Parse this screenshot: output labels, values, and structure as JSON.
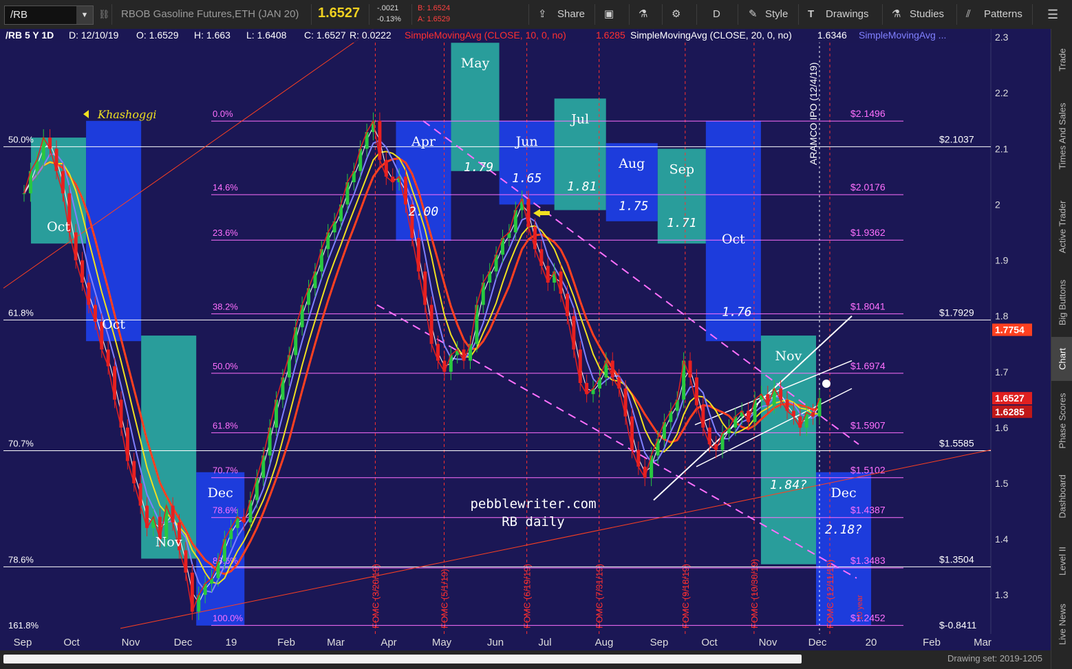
{
  "toolbar": {
    "symbol": "/RB",
    "description": "RBOB Gasoline Futures,ETH (JAN 20)",
    "last": "1.6527",
    "change": "-.0021",
    "change_pct": "-0.13%",
    "bid": "B: 1.6524",
    "ask": "A: 1.6529",
    "share": "Share",
    "style": "Style",
    "drawings": "Drawings",
    "studies": "Studies",
    "patterns": "Patterns",
    "aggregation": "D"
  },
  "sidebar": {
    "tabs": [
      "Trade",
      "Times And Sales",
      "Active Trader",
      "Big Buttons",
      "Chart",
      "Phase Scores",
      "Dashboard",
      "Level II",
      "Live News"
    ]
  },
  "bottom": {
    "drawing_set": "Drawing set: 2019-1205"
  },
  "colors": {
    "background": "#1b1755",
    "green_box": "#2aa8a0",
    "blue_box": "#1d3fe6",
    "fib": "#ff70ff",
    "sma10": "#e02020",
    "sma20": "#ffffff",
    "sma50": "#8080ff",
    "sma100": "#f0e020",
    "sma200": "#ff4020"
  },
  "chart_data": {
    "type": "candlestick",
    "title": "/RB 5 Y 1D",
    "header": {
      "date": "D: 12/10/19",
      "open": "O: 1.6529",
      "high": "H: 1.663",
      "low": "L: 1.6408",
      "close": "C: 1.6527",
      "range": "R: 0.0222",
      "sma10": "SimpleMovingAvg (CLOSE, 10, 0, no)",
      "sma10_value": "1.6285",
      "sma20": "SimpleMovingAvg (CLOSE, 20, 0, no)",
      "sma20_value": "1.6346",
      "sma_more": "SimpleMovingAvg ..."
    },
    "x_ticks": [
      "Sep",
      "Oct",
      "Nov",
      "Dec",
      "19",
      "Feb",
      "Mar",
      "Apr",
      "May",
      "Jun",
      "Jul",
      "Aug",
      "Sep",
      "Oct",
      "Nov",
      "Dec",
      "20",
      "Feb",
      "Mar"
    ],
    "y_ticks": [
      1.3,
      1.4,
      1.5,
      1.6,
      1.7,
      1.8,
      1.9,
      2.0,
      2.1,
      2.2,
      2.3
    ],
    "y_tick_labels": [
      "1.3",
      "1.4",
      "1.5",
      "1.6",
      "1.7",
      "1.8",
      "1.9",
      "2",
      "2.1",
      "2.2",
      "2.3"
    ],
    "ylim": [
      1.23,
      2.31
    ],
    "price_markers": [
      {
        "label": "1.7754",
        "value": 1.7754,
        "color": "#ff4020"
      },
      {
        "label": "1.6527",
        "value": 1.6527,
        "color": "#e02020"
      },
      {
        "label": "1.6285",
        "value": 1.6285,
        "color": "#c01818"
      }
    ],
    "fib_levels": [
      {
        "pct": "0.0%",
        "price": "$2.1496",
        "value": 2.1496
      },
      {
        "pct": "14.6%",
        "price": "$2.0176",
        "value": 2.0176
      },
      {
        "pct": "23.6%",
        "price": "$1.9362",
        "value": 1.9362
      },
      {
        "pct": "38.2%",
        "price": "$1.8041",
        "value": 1.8041
      },
      {
        "pct": "50.0%",
        "price": "$1.6974",
        "value": 1.6974
      },
      {
        "pct": "61.8%",
        "price": "$1.5907",
        "value": 1.5907
      },
      {
        "pct": "70.7%",
        "price": "$1.5102",
        "value": 1.5102
      },
      {
        "pct": "78.6%",
        "price": "$1.4387",
        "value": 1.4387
      },
      {
        "pct": "88.6%",
        "price": "$1.3483",
        "value": 1.3483
      },
      {
        "pct": "100.0%",
        "price": "$1.2452",
        "value": 1.2452
      }
    ],
    "long_levels": [
      {
        "pct": "50.0%",
        "price": "$2.1037",
        "value": 2.1037
      },
      {
        "pct": "61.8%",
        "price": "$1.7929",
        "value": 1.7929
      },
      {
        "pct": "70.7%",
        "price": "$1.5585",
        "value": 1.5585
      },
      {
        "pct": "78.6%",
        "price": "$1.3504",
        "value": 1.3504
      },
      {
        "pct": "161.8%",
        "price": "$-0.8411",
        "value": null
      }
    ],
    "monthly_boxes": [
      {
        "label": "Oct",
        "color": "green",
        "t0": 0.01,
        "t1": 0.09,
        "top": 2.12,
        "bottom": 1.93
      },
      {
        "label": "Oct",
        "color": "blue",
        "t0": 0.09,
        "t1": 0.17,
        "top": 2.15,
        "bottom": 1.755
      },
      {
        "label": "Nov",
        "color": "green",
        "t0": 0.17,
        "t1": 0.25,
        "top": 1.765,
        "bottom": 1.365
      },
      {
        "label": "Dec",
        "color": "blue",
        "t0": 0.25,
        "t1": 0.32,
        "top": 1.52,
        "bottom": 1.245
      },
      {
        "label": "Apr",
        "color": "blue",
        "t0": 0.54,
        "t1": 0.62,
        "top": 2.15,
        "bottom": 1.935
      },
      {
        "label": "May",
        "color": "green",
        "t0": 0.62,
        "t1": 0.69,
        "top": 2.29,
        "bottom": 2.06
      },
      {
        "label": "Jun",
        "color": "blue",
        "t0": 0.69,
        "t1": 0.77,
        "top": 2.15,
        "bottom": 2.0
      },
      {
        "label": "Jul",
        "color": "green",
        "t0": 0.77,
        "t1": 0.845,
        "top": 2.19,
        "bottom": 1.99
      },
      {
        "label": "Aug",
        "color": "blue",
        "t0": 0.845,
        "t1": 0.92,
        "top": 2.11,
        "bottom": 1.97
      },
      {
        "label": "Sep",
        "color": "green",
        "t0": 0.92,
        "t1": 0.99,
        "top": 2.1,
        "bottom": 1.93
      },
      {
        "label": "Oct",
        "color": "blue",
        "t0": 0.99,
        "t1": 1.07,
        "top": 2.15,
        "bottom": 1.755
      },
      {
        "label": "Nov",
        "color": "green",
        "t0": 1.07,
        "t1": 1.15,
        "top": 1.765,
        "bottom": 1.355
      },
      {
        "label": "Dec",
        "color": "blue",
        "t0": 1.15,
        "t1": 1.23,
        "top": 1.52,
        "bottom": 1.245
      }
    ],
    "monthly_values": [
      {
        "text": "2.00",
        "t": 0.58,
        "y": 1.98
      },
      {
        "text": "1.79",
        "t": 0.66,
        "y": 2.06
      },
      {
        "text": "1.65",
        "t": 0.73,
        "y": 2.04
      },
      {
        "text": "1.81",
        "t": 0.81,
        "y": 2.025
      },
      {
        "text": "1.75",
        "t": 0.885,
        "y": 1.99
      },
      {
        "text": "1.71",
        "t": 0.955,
        "y": 1.96
      },
      {
        "text": "1.76",
        "t": 1.035,
        "y": 1.8
      },
      {
        "text": "1.84?",
        "t": 1.11,
        "y": 1.49
      },
      {
        "text": "2.18?",
        "t": 1.19,
        "y": 1.41
      }
    ],
    "fomc_dates": [
      {
        "label": "FOMC (3/20/19)",
        "t": 0.51
      },
      {
        "label": "FOMC (5/1/19)",
        "t": 0.61
      },
      {
        "label": "FOMC (6/19/19)",
        "t": 0.73
      },
      {
        "label": "FOMC (7/31/19)",
        "t": 0.835
      },
      {
        "label": "FOMC (9/18/19)",
        "t": 0.96
      },
      {
        "label": "FOMC (10/30/19)",
        "t": 1.06
      },
      {
        "label": "FOMC (12/11/19)",
        "t": 1.17
      }
    ],
    "annotations": {
      "khashoggi": "Khashoggi",
      "aramco": "ARAMCO IPO (12/4/19)",
      "site": "pebblewriter.com",
      "subtitle": "RB daily",
      "small": "10 year"
    },
    "closes": [
      2.02,
      2.06,
      2.08,
      2.12,
      2.1,
      2.06,
      2.02,
      1.95,
      1.9,
      1.86,
      1.82,
      1.79,
      1.74,
      1.71,
      1.65,
      1.6,
      1.54,
      1.5,
      1.46,
      1.42,
      1.44,
      1.4,
      1.46,
      1.43,
      1.38,
      1.34,
      1.27,
      1.3,
      1.32,
      1.33,
      1.36,
      1.4,
      1.42,
      1.44,
      1.43,
      1.47,
      1.51,
      1.55,
      1.6,
      1.65,
      1.69,
      1.73,
      1.78,
      1.82,
      1.85,
      1.88,
      1.92,
      1.95,
      1.97,
      2.0,
      2.04,
      2.06,
      2.1,
      2.13,
      2.15,
      2.08,
      2.05,
      2.04,
      2.05,
      2.0,
      1.94,
      1.88,
      1.82,
      1.75,
      1.72,
      1.7,
      1.73,
      1.74,
      1.72,
      1.75,
      1.82,
      1.86,
      1.88,
      1.91,
      1.94,
      1.95,
      1.99,
      2.01,
      1.96,
      1.92,
      1.89,
      1.86,
      1.88,
      1.84,
      1.8,
      1.74,
      1.68,
      1.66,
      1.67,
      1.69,
      1.72,
      1.69,
      1.67,
      1.62,
      1.56,
      1.53,
      1.51,
      1.55,
      1.58,
      1.61,
      1.63,
      1.65,
      1.72,
      1.69,
      1.64,
      1.6,
      1.57,
      1.56,
      1.59,
      1.6,
      1.62,
      1.63,
      1.61,
      1.65,
      1.66,
      1.64,
      1.67,
      1.65,
      1.63,
      1.62,
      1.6,
      1.6274,
      1.62,
      1.6527
    ]
  }
}
